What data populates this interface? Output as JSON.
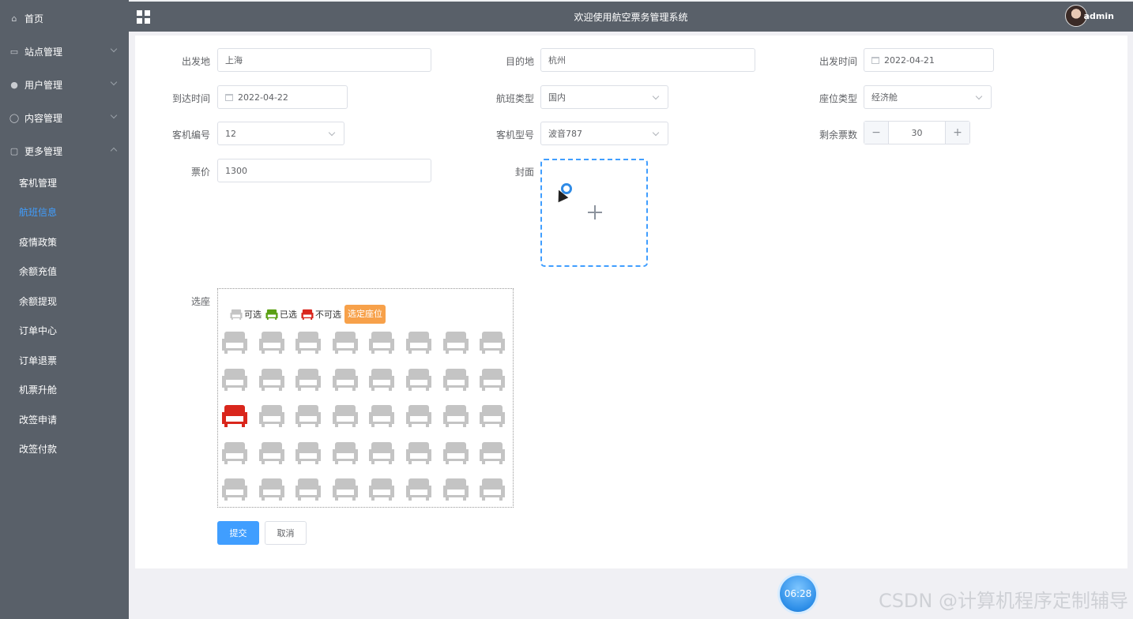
{
  "sidebar": {
    "items": [
      {
        "label": "首页",
        "icon": "home-icon"
      },
      {
        "label": "站点管理",
        "icon": "cart-icon"
      },
      {
        "label": "用户管理",
        "icon": "user-icon"
      },
      {
        "label": "内容管理",
        "icon": "chat-icon"
      },
      {
        "label": "更多管理",
        "icon": "copy-icon"
      }
    ],
    "subitems": [
      "客机管理",
      "航班信息",
      "疫情政策",
      "余额充值",
      "余额提现",
      "订单中心",
      "订单退票",
      "机票升舱",
      "改签申请",
      "改签付款"
    ],
    "active": "航班信息"
  },
  "header": {
    "title": "欢迎使用航空票务管理系统",
    "user": "admin"
  },
  "form": {
    "origin_label": "出发地",
    "origin_value": "上海",
    "destination_label": "目的地",
    "destination_value": "杭州",
    "depart_time_label": "出发时间",
    "depart_time_value": "2022-04-21",
    "arrive_time_label": "到达时间",
    "arrive_time_value": "2022-04-22",
    "flight_type_label": "航班类型",
    "flight_type_value": "国内",
    "seat_type_label": "座位类型",
    "seat_type_value": "经济舱",
    "aircraft_no_label": "客机编号",
    "aircraft_no_value": "12",
    "aircraft_model_label": "客机型号",
    "aircraft_model_value": "波音787",
    "tickets_left_label": "剩余票数",
    "tickets_left_value": "30",
    "stepper_minus": "−",
    "stepper_plus": "+",
    "price_label": "票价",
    "price_value": "1300",
    "cover_label": "封面",
    "seat_label": "选座",
    "submit_label": "提交",
    "cancel_label": "取消"
  },
  "seat_map": {
    "legend_available": "可选",
    "legend_selected": "已选",
    "legend_unavailable": "不可选",
    "choose_button": "选定座位",
    "rows": 5,
    "cols": 8,
    "unavailable": [
      [
        2,
        0
      ]
    ],
    "colors": {
      "available": "#c4c4c4",
      "selected": "#5aa012",
      "unavailable": "#d9261c"
    }
  },
  "overlay": {
    "timer": "06:28",
    "watermark": "CSDN @计算机程序定制辅导"
  }
}
